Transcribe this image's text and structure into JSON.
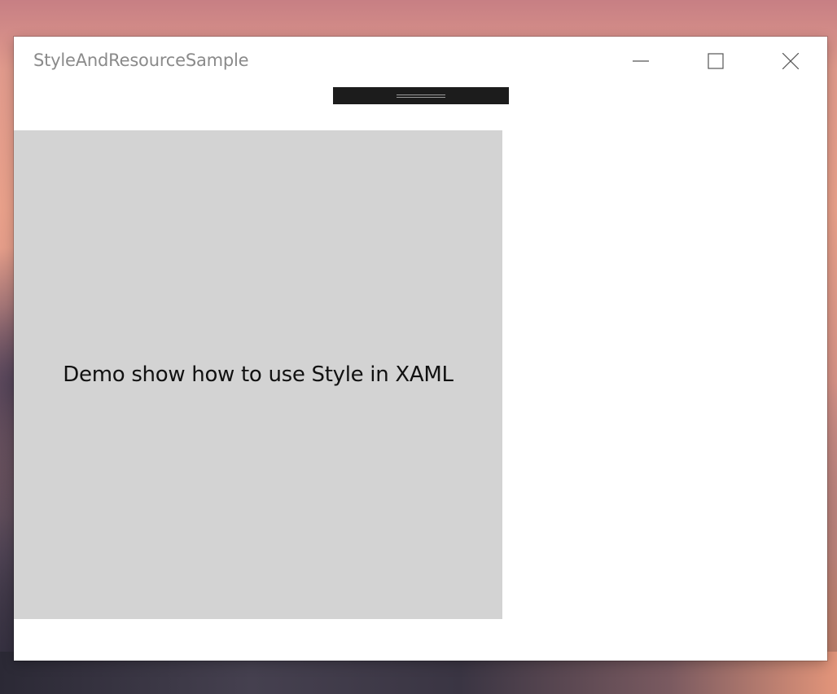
{
  "window": {
    "title": "StyleAndResourceSample"
  },
  "caption_buttons": {
    "minimize_icon": "minimize-icon",
    "maximize_icon": "maximize-icon",
    "close_icon": "close-icon"
  },
  "content": {
    "demo_text": "Demo show how to use Style in XAML"
  },
  "colors": {
    "panel_background": "#d3d3d3",
    "drag_handle": "#1c1c1c",
    "window_background": "#ffffff"
  }
}
